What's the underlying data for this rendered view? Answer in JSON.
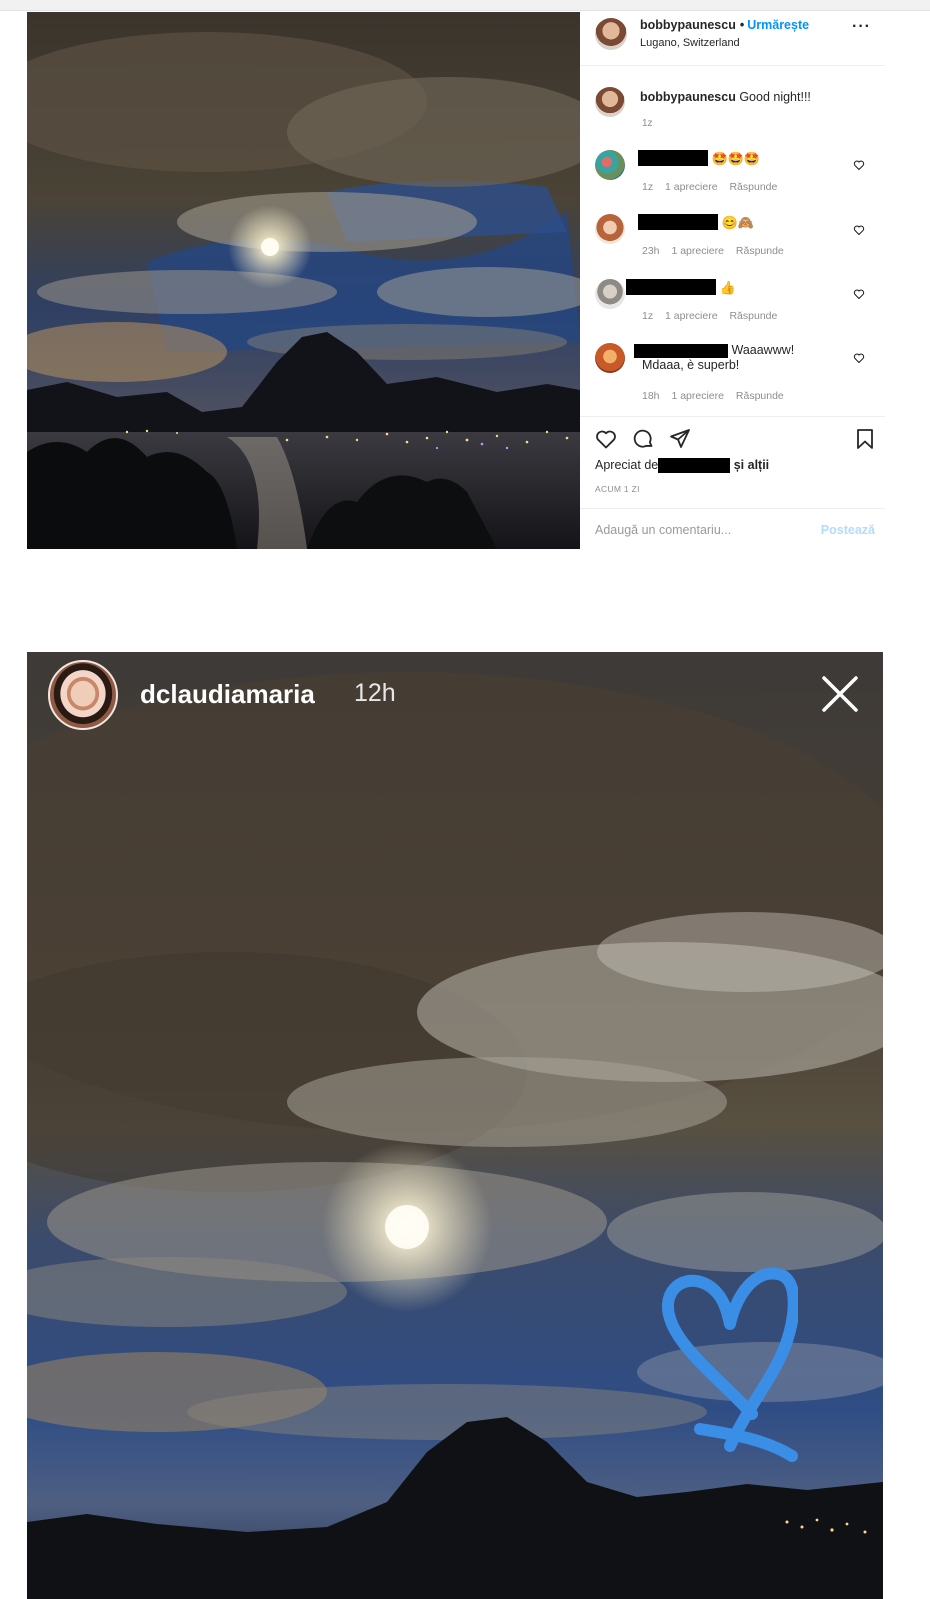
{
  "post": {
    "header": {
      "username": "bobbypaunescu",
      "separator": "•",
      "follow_label": "Urmărește",
      "location": "Lugano, Switzerland",
      "more_label": "···"
    },
    "caption": {
      "username": "bobbypaunescu",
      "text": "Good night!!!",
      "time": "1z"
    },
    "comments": [
      {
        "emoji": "🤩🤩🤩",
        "text": "",
        "time": "1z",
        "likes": "1 apreciere",
        "reply": "Răspunde"
      },
      {
        "emoji": "😊🙈",
        "text": "",
        "time": "23h",
        "likes": "1 apreciere",
        "reply": "Răspunde"
      },
      {
        "emoji": "👍",
        "text": "",
        "time": "1z",
        "likes": "1 apreciere",
        "reply": "Răspunde"
      },
      {
        "emoji": "",
        "text": "Waaawww!",
        "text2": "Mdaaa, è superb!",
        "time": "18h",
        "likes": "1 apreciere",
        "reply": "Răspunde"
      }
    ],
    "liked_by_prefix": "Apreciat de",
    "liked_by_suffix": "și alții",
    "date": "ACUM 1 ZI",
    "add_comment_placeholder": "Adaugă un comentariu...",
    "post_button": "Postează"
  },
  "story": {
    "username": "dclaudiamaria",
    "time": "12h",
    "heart_color": "#3a8ee6"
  },
  "colors": {
    "link_blue": "#0095f6",
    "muted": "#8e8e8e",
    "post_disabled": "#b3dbff"
  }
}
